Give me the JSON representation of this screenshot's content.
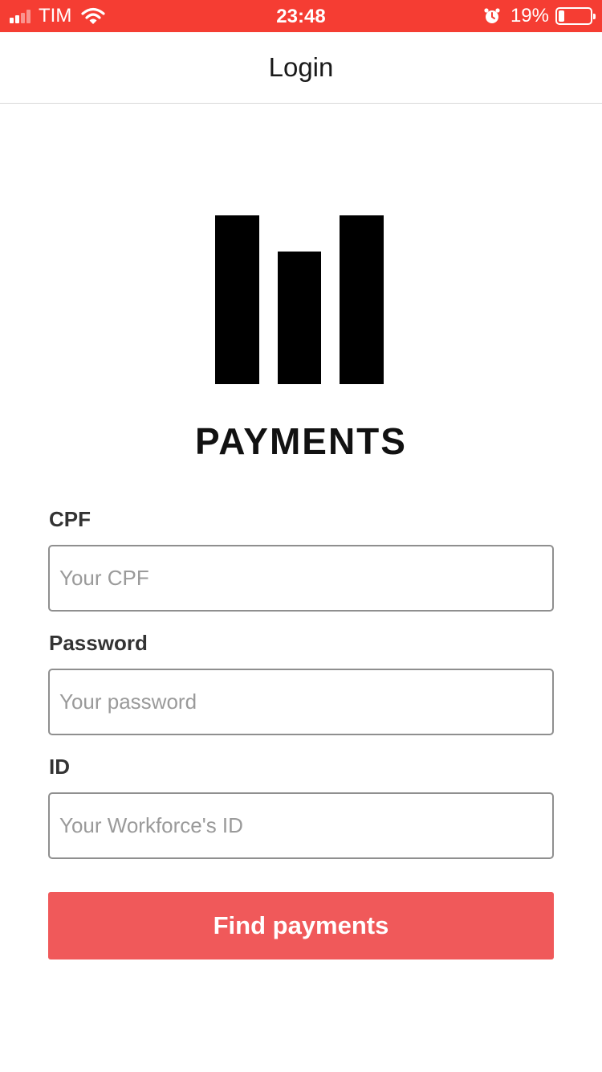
{
  "status_bar": {
    "carrier": "TIM",
    "time": "23:48",
    "battery_percent_text": "19%",
    "battery_level": 0.19,
    "signal_bars_active": 2,
    "signal_bars_total": 4,
    "background_color": "#f53d33",
    "icons": [
      "cellular-signal-icon",
      "wifi-icon",
      "alarm-icon",
      "battery-icon"
    ]
  },
  "nav": {
    "title": "Login"
  },
  "logo": {
    "text": "PAYMENTS",
    "mark": "bar-logo-icon"
  },
  "form": {
    "cpf": {
      "label": "CPF",
      "placeholder": "Your CPF"
    },
    "password": {
      "label": "Password",
      "placeholder": "Your password"
    },
    "id": {
      "label": "ID",
      "placeholder": "Your Workforce's ID"
    },
    "submit_label": "Find payments"
  },
  "colors": {
    "accent_button": "#f0595a",
    "status_bar": "#f53d33",
    "input_border": "#8f8f8f"
  }
}
